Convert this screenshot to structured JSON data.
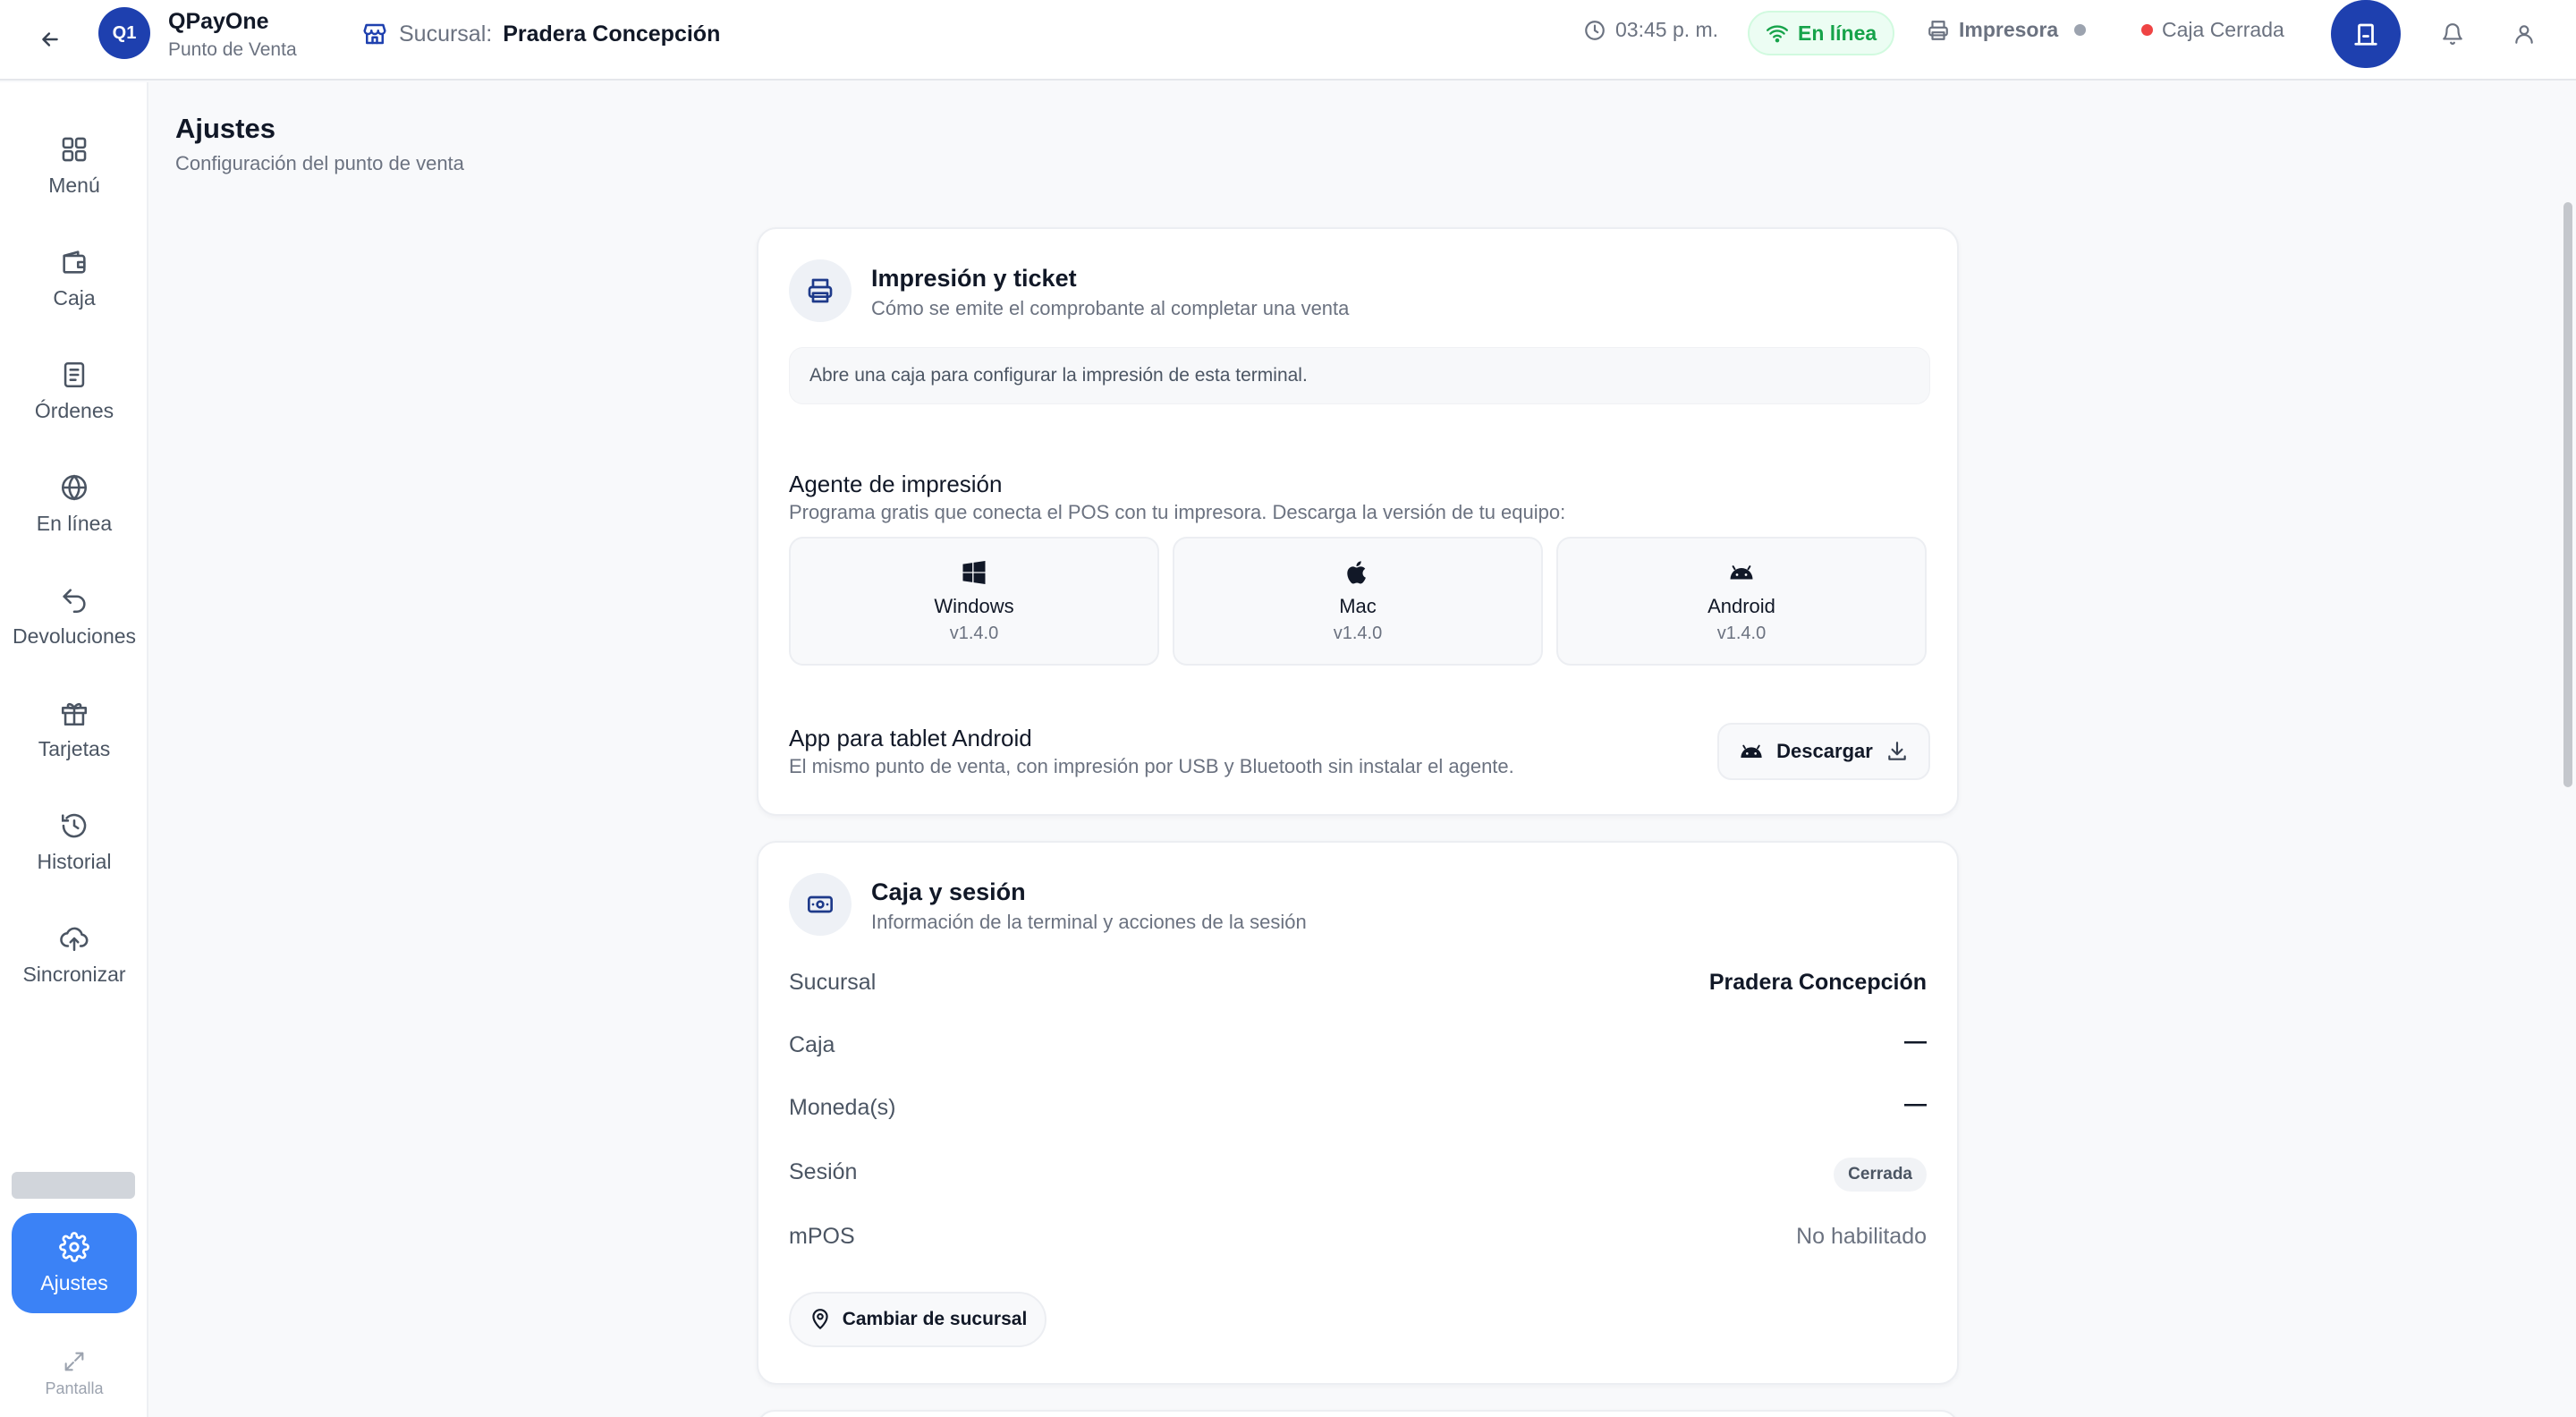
{
  "topbar": {
    "brand_badge": "Q1",
    "brand_name": "QPayOne",
    "brand_subtitle": "Punto de Venta",
    "branch_label": "Sucursal:",
    "branch_name": "Pradera Concepción",
    "time": "03:45 p. m.",
    "online_status": "En línea",
    "printer_label": "Impresora",
    "cash_state": "Caja Cerrada",
    "colors": {
      "online": "#16a34a",
      "cash_closed_dot": "#ef4444",
      "printer_dot": "#9ca3af",
      "primary": "#1e40af"
    }
  },
  "sidebar": {
    "items": [
      {
        "label": "Menú",
        "icon": "grid-icon"
      },
      {
        "label": "Caja",
        "icon": "wallet-icon"
      },
      {
        "label": "Órdenes",
        "icon": "receipt-icon"
      },
      {
        "label": "En línea",
        "icon": "globe-icon"
      },
      {
        "label": "Devoluciones",
        "icon": "undo-icon"
      },
      {
        "label": "Tarjetas",
        "icon": "gift-icon"
      },
      {
        "label": "Historial",
        "icon": "history-icon"
      },
      {
        "label": "Sincronizar",
        "icon": "cloud-upload-icon"
      }
    ],
    "active": {
      "label": "Ajustes",
      "icon": "gear-icon"
    },
    "screen": {
      "label": "Pantalla",
      "icon": "expand-icon"
    },
    "active_color": "#3b82f6"
  },
  "page": {
    "title": "Ajustes",
    "subtitle": "Configuración del punto de venta"
  },
  "printing": {
    "title": "Impresión y ticket",
    "description": "Cómo se emite el comprobante al completar una venta",
    "notice": "Abre una caja para configurar la impresión de esta terminal.",
    "agent_title": "Agente de impresión",
    "agent_description": "Programa gratis que conecta el POS con tu impresora. Descarga la versión de tu equipo:",
    "platforms": [
      {
        "name": "Windows",
        "version": "v1.4.0",
        "icon": "windows-icon"
      },
      {
        "name": "Mac",
        "version": "v1.4.0",
        "icon": "apple-icon"
      },
      {
        "name": "Android",
        "version": "v1.4.0",
        "icon": "android-icon"
      }
    ],
    "tablet_title": "App para tablet Android",
    "tablet_description": "El mismo punto de venta, con impresión por USB y Bluetooth sin instalar el agente.",
    "download_label": "Descargar"
  },
  "session": {
    "title": "Caja y sesión",
    "description": "Información de la terminal y acciones de la sesión",
    "rows": {
      "branch": {
        "label": "Sucursal",
        "value": "Pradera Concepción"
      },
      "register": {
        "label": "Caja",
        "value": "—"
      },
      "currency": {
        "label": "Moneda(s)",
        "value": "—"
      },
      "session": {
        "label": "Sesión",
        "value": "Cerrada"
      },
      "mpos": {
        "label": "mPOS",
        "value": "No habilitado"
      }
    },
    "change_branch_label": "Cambiar de sucursal"
  }
}
